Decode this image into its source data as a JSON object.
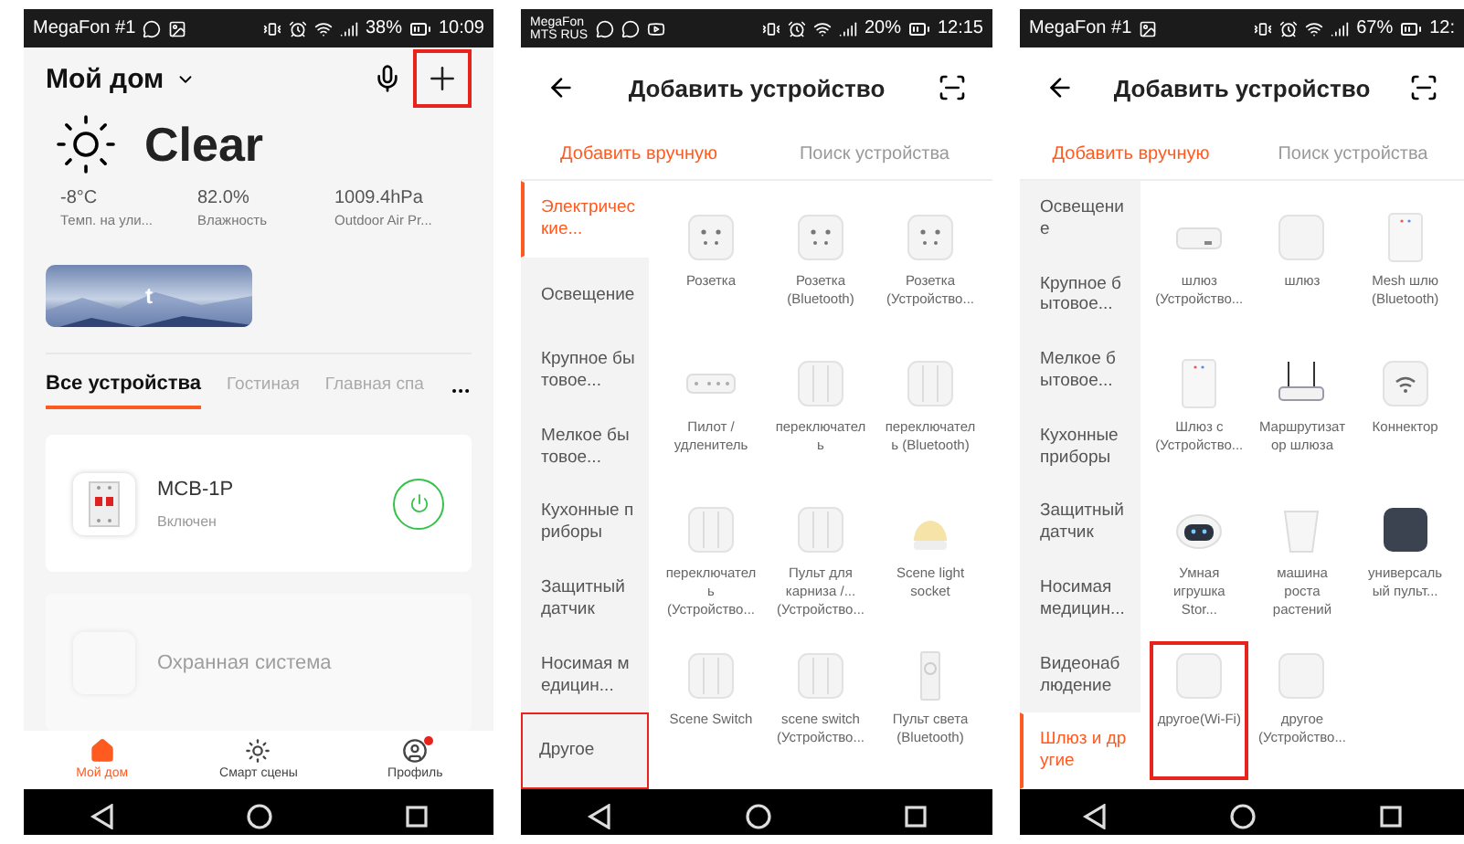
{
  "phones": [
    {
      "kind": "home",
      "status_bar": {
        "carrier": [
          "MegaFon #1"
        ],
        "notification_icons": [
          {
            "kind": "chat"
          },
          {
            "kind": "image"
          }
        ],
        "battery": "38%",
        "time": "10:09"
      },
      "home_title": "Мой дом",
      "add_highlighted": true,
      "weather": {
        "condition": "Clear",
        "stats": [
          {
            "value": "-8°C",
            "label": "Темп. на ули..."
          },
          {
            "value": "82.0%",
            "label": "Влажность"
          },
          {
            "value": "1009.4hPa",
            "label": "Outdoor Air Pr..."
          }
        ]
      },
      "banner_text": "t",
      "room_tabs": [
        {
          "label": "Все устройства",
          "selected": true
        },
        {
          "label": "Гостиная",
          "selected": false
        },
        {
          "label": "Главная спа",
          "selected": false
        }
      ],
      "devices": [
        {
          "name": "MCB-1P",
          "status": "Включен",
          "on": true,
          "dimmed": false
        },
        {
          "name": "Охранная система",
          "dimmed": true
        }
      ],
      "bottom_nav": [
        {
          "label": "Мой дом",
          "selected": true,
          "badge": false,
          "kind": "home"
        },
        {
          "label": "Смарт сцены",
          "selected": false,
          "badge": false,
          "kind": "scenes"
        },
        {
          "label": "Профиль",
          "selected": false,
          "badge": true,
          "kind": "profile"
        }
      ]
    },
    {
      "kind": "add",
      "status_bar": {
        "carrier": [
          "MegaFon",
          "MTS RUS"
        ],
        "notification_icons": [
          {
            "kind": "chat"
          },
          {
            "kind": "chat"
          },
          {
            "kind": "video"
          }
        ],
        "battery": "20%",
        "time": "12:15"
      },
      "title": "Добавить устройство",
      "mode_tabs": [
        {
          "label": "Добавить вручную",
          "selected": true
        },
        {
          "label": "Поиск устройства",
          "selected": false
        }
      ],
      "categories": [
        {
          "label": "Электрические...",
          "selected": true,
          "highlighted": false
        },
        {
          "label": "Освещение",
          "selected": false,
          "highlighted": false
        },
        {
          "label": "Крупное бытовое...",
          "selected": false,
          "highlighted": false
        },
        {
          "label": "Мелкое бытовое...",
          "selected": false,
          "highlighted": false
        },
        {
          "label": "Кухонные приборы",
          "selected": false,
          "highlighted": false
        },
        {
          "label": "Защитный датчик",
          "selected": false,
          "highlighted": false
        },
        {
          "label": "Носимая медицин...",
          "selected": false,
          "highlighted": false
        },
        {
          "label": "Другое",
          "selected": false,
          "highlighted": true
        }
      ],
      "products": [
        {
          "name": "Розетка",
          "kind": "socket",
          "highlighted": false
        },
        {
          "name": "Розетка (Bluetooth)",
          "kind": "socket",
          "highlighted": false
        },
        {
          "name": "Розетка (Устройство...",
          "kind": "socket",
          "highlighted": false
        },
        {
          "name": "Пилот / удленитель",
          "kind": "strip",
          "highlighted": false
        },
        {
          "name": "переключатель",
          "kind": "switch",
          "highlighted": false
        },
        {
          "name": "переключатель (Bluetooth)",
          "kind": "switch",
          "highlighted": false
        },
        {
          "name": "переключатель (Устройство...",
          "kind": "switch",
          "highlighted": false
        },
        {
          "name": "Пульт для карниза /... (Устройство...",
          "kind": "switch",
          "highlighted": false
        },
        {
          "name": "Scene light socket",
          "kind": "lamp",
          "highlighted": false
        },
        {
          "name": "Scene Switch",
          "kind": "switch",
          "highlighted": false
        },
        {
          "name": "scene switch (Устройство...",
          "kind": "switch",
          "highlighted": false
        },
        {
          "name": "Пульт света (Bluetooth)",
          "kind": "remote",
          "highlighted": false
        }
      ]
    },
    {
      "kind": "add",
      "status_bar": {
        "carrier": [
          "MegaFon #1"
        ],
        "notification_icons": [
          {
            "kind": "image"
          }
        ],
        "battery": "67%",
        "time": "12:"
      },
      "title": "Добавить устройство",
      "mode_tabs": [
        {
          "label": "Добавить вручную",
          "selected": true
        },
        {
          "label": "Поиск устройства",
          "selected": false
        }
      ],
      "categories": [
        {
          "label": "Освещение",
          "selected": false,
          "highlighted": false
        },
        {
          "label": "Крупное бытовое...",
          "selected": false,
          "highlighted": false
        },
        {
          "label": "Мелкое бытовое...",
          "selected": false,
          "highlighted": false
        },
        {
          "label": "Кухонные приборы",
          "selected": false,
          "highlighted": false
        },
        {
          "label": "Защитный датчик",
          "selected": false,
          "highlighted": false
        },
        {
          "label": "Носимая медицин...",
          "selected": false,
          "highlighted": false
        },
        {
          "label": "Видеонаблюдение",
          "selected": false,
          "highlighted": false
        },
        {
          "label": "Шлюз и другие",
          "selected": true,
          "highlighted": false
        }
      ],
      "products": [
        {
          "name": "шлюз (Устройство...",
          "kind": "hub",
          "highlighted": false
        },
        {
          "name": "шлюз",
          "kind": "plain",
          "highlighted": false
        },
        {
          "name": "Mesh шлю (Bluetooth)",
          "kind": "tower",
          "highlighted": false
        },
        {
          "name": "Шлюз с (Устройство...",
          "kind": "tower",
          "highlighted": false
        },
        {
          "name": "Маршрутизатор шлюза",
          "kind": "router",
          "highlighted": false
        },
        {
          "name": "Коннектор",
          "kind": "wifi",
          "highlighted": false
        },
        {
          "name": "Умная игрушка Stor...",
          "kind": "robot",
          "highlighted": false
        },
        {
          "name": "машина роста растений",
          "kind": "pot",
          "highlighted": false
        },
        {
          "name": "универсаль ый пульт...",
          "kind": "dark",
          "highlighted": false
        },
        {
          "name": "другое(Wi-Fi)",
          "kind": "plain",
          "highlighted": true
        },
        {
          "name": "другое (Устройство...",
          "kind": "plain",
          "highlighted": false
        }
      ]
    }
  ]
}
